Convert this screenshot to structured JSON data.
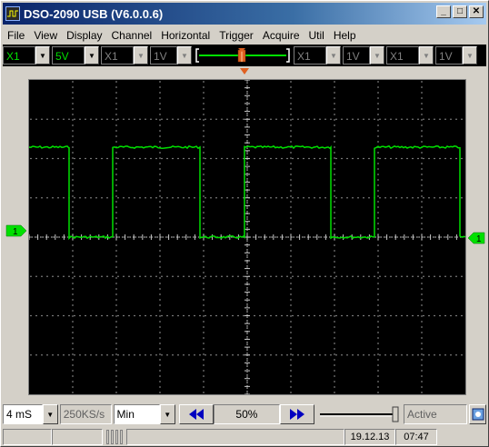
{
  "window": {
    "title": "DSO-2090 USB (V6.0.0.6)"
  },
  "menu": [
    "File",
    "View",
    "Display",
    "Channel",
    "Horizontal",
    "Trigger",
    "Acquire",
    "Util",
    "Help"
  ],
  "toolbar": {
    "ch1_probe": "X1",
    "ch1_volts": "5V",
    "ch2_probe": "X1",
    "ch2_volts": "1V",
    "ch3_probe": "X1",
    "ch3_volts": "1V",
    "ch4_probe": "X1",
    "ch4_volts": "1V"
  },
  "scope": {
    "trace_color": "#00e000",
    "grid_color": "#c8c8c8",
    "ch1_marker": "1",
    "trig_level_marker": "1"
  },
  "bottom": {
    "timebase": "4 mS",
    "sample_rate": "250KS/s",
    "mode": "Min",
    "position": "50%",
    "status": "Active"
  },
  "statusbar": {
    "date": "19.12.13",
    "time": "07:47"
  }
}
